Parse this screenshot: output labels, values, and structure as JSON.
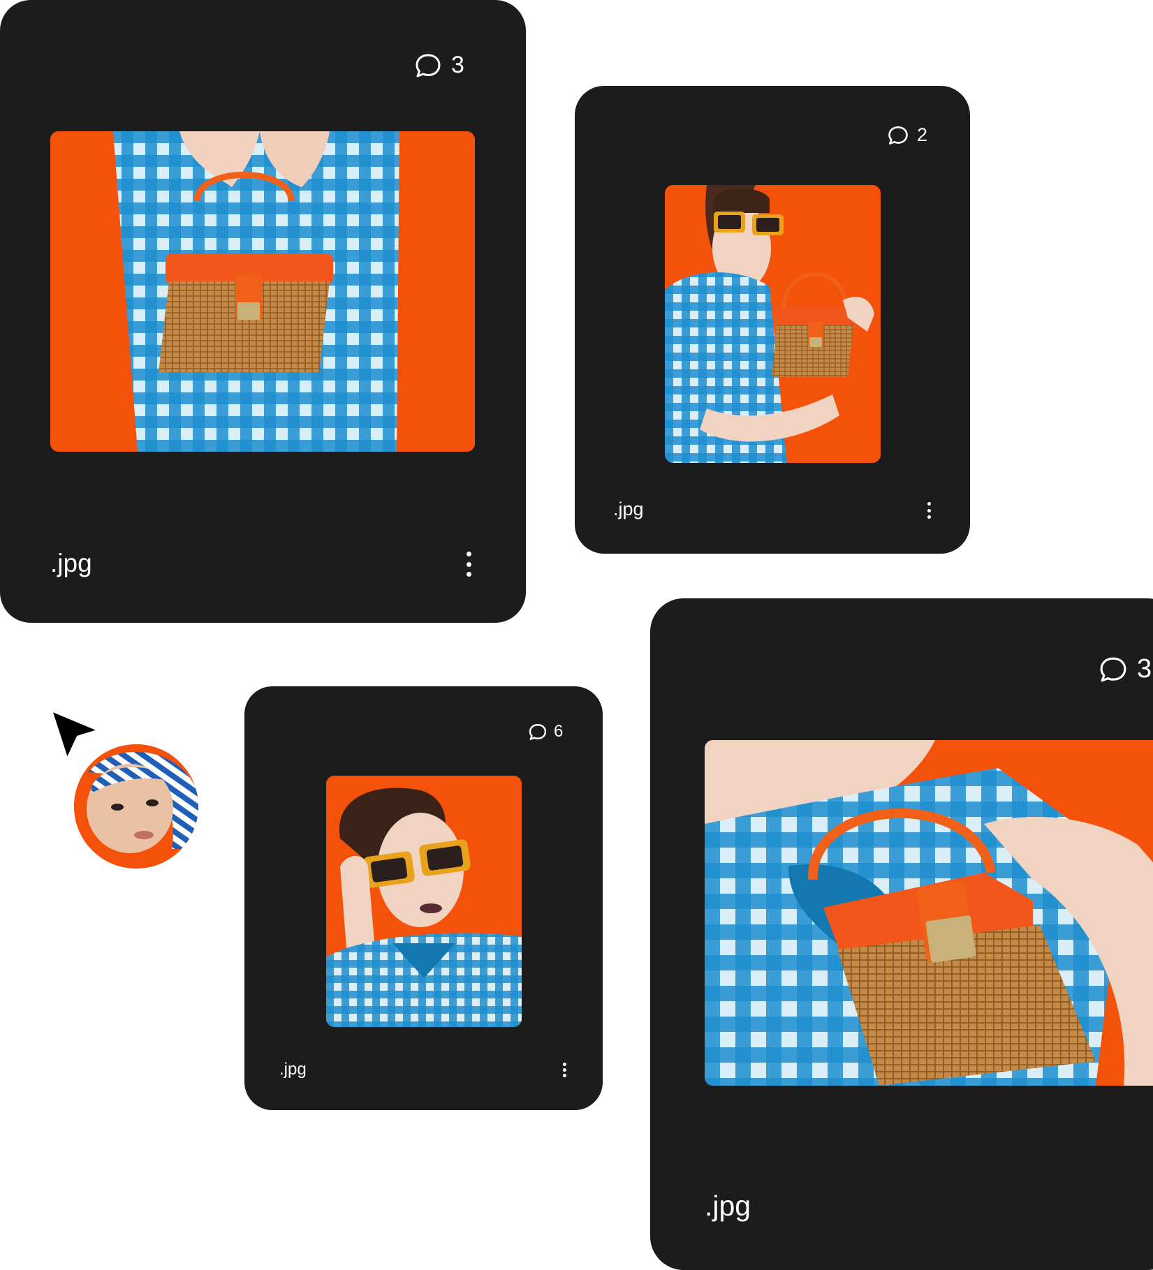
{
  "colors": {
    "card_bg": "#1c1c1c",
    "accent_orange": "#f4520b",
    "gingham_blue": "#1e8fcf",
    "text": "#ffffff"
  },
  "cards": [
    {
      "comment_count": "3",
      "filename": ".jpg",
      "image": "model holding a wicker basket handbag, gingham dress"
    },
    {
      "comment_count": "2",
      "filename": ".jpg",
      "image": "model in yellow sunglasses holding wicker handbag"
    },
    {
      "comment_count": "6",
      "filename": ".jpg",
      "image": "model adjusting yellow sunglasses"
    },
    {
      "comment_count": "3",
      "filename": ".jpg",
      "image": "close-up of wicker handbag held against gingham shirt"
    }
  ],
  "icons": {
    "comment": "comment-bubble-icon",
    "menu": "more-vertical-icon",
    "pointer": "cursor-arrow-icon"
  },
  "collaborator": {
    "avatar": "person in blue striped headscarf"
  }
}
